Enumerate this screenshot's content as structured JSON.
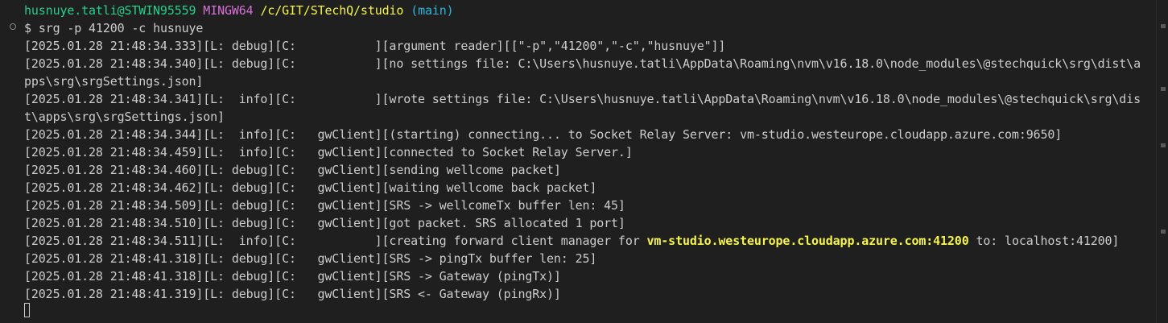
{
  "prompt": {
    "user_host": "husnuye.tatli@STWIN95559",
    "shell": "MINGW64",
    "path": "/c/GIT/STechQ/studio",
    "branch": "(main)",
    "symbol": "$",
    "command": "srg -p 41200 -c husnuye"
  },
  "log_lines": [
    "[2025.01.28 21:48:34.333][L: debug][C:           ][argument reader][[\"-p\",\"41200\",\"-c\",\"husnuye\"]]",
    "[2025.01.28 21:48:34.340][L: debug][C:           ][no settings file: C:\\Users\\husnuye.tatli\\AppData\\Roaming\\nvm\\v16.18.0\\node_modules\\@stechquick\\srg\\dist\\a",
    "pps\\srg\\srgSettings.json]",
    "[2025.01.28 21:48:34.341][L:  info][C:           ][wrote settings file: C:\\Users\\husnuye.tatli\\AppData\\Roaming\\nvm\\v16.18.0\\node_modules\\@stechquick\\srg\\dis",
    "t\\apps\\srg\\srgSettings.json]",
    "[2025.01.28 21:48:34.344][L:  info][C:   gwClient][(starting) connecting... to Socket Relay Server: vm-studio.westeurope.cloudapp.azure.com:9650]",
    "[2025.01.28 21:48:34.459][L:  info][C:   gwClient][connected to Socket Relay Server.]",
    "[2025.01.28 21:48:34.460][L: debug][C:   gwClient][sending wellcome packet]",
    "[2025.01.28 21:48:34.462][L: debug][C:   gwClient][waiting wellcome back packet]",
    "[2025.01.28 21:48:34.509][L: debug][C:   gwClient][SRS -> wellcomeTx buffer len: 45]",
    "[2025.01.28 21:48:34.510][L: debug][C:   gwClient][got packet. SRS allocated 1 port]"
  ],
  "forward_line": {
    "prefix": "[2025.01.28 21:48:34.511][L:  info][C:           ][creating forward client manager for ",
    "host": "vm-studio.westeurope.cloudapp.azure.com:41200",
    "suffix": " to: localhost:41200]"
  },
  "tail_lines": [
    "[2025.01.28 21:48:41.318][L: debug][C:   gwClient][SRS -> pingTx buffer len: 25]",
    "[2025.01.28 21:48:41.318][L: debug][C:   gwClient][SRS -> Gateway (pingTx)]",
    "[2025.01.28 21:48:41.319][L: debug][C:   gwClient][SRS <- Gateway (pingRx)]"
  ],
  "colors": {
    "background": "#1f1f1f",
    "text": "#cccccc",
    "green": "#23d18b",
    "magenta": "#d670d6",
    "yellow": "#f5f543",
    "cyan": "#29b8db"
  },
  "icons": {
    "gutter": "command-decoration-circle-icon",
    "cursor": "block-cursor"
  }
}
